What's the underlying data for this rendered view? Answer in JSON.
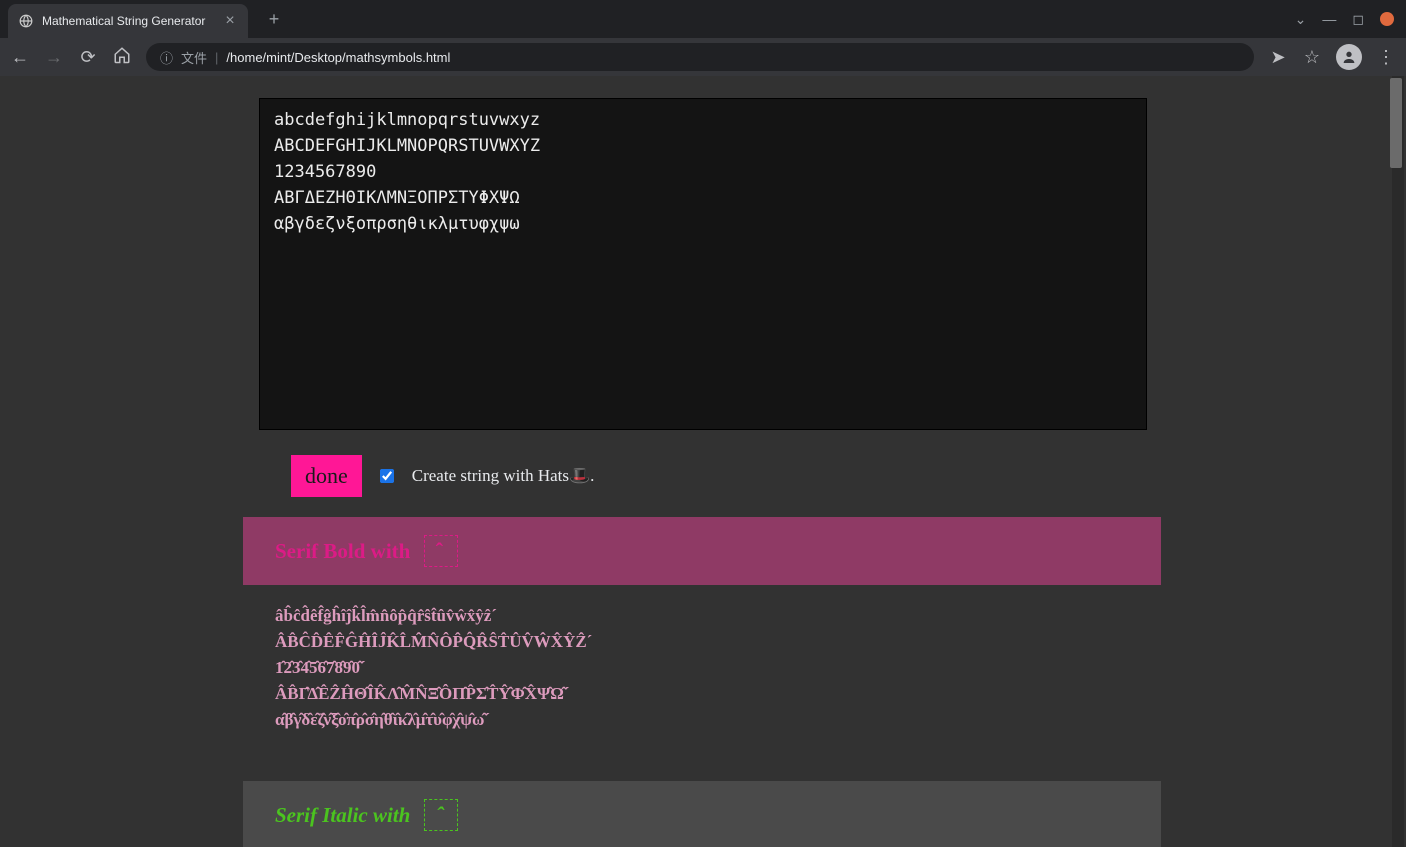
{
  "browser": {
    "tab_title": "Mathematical String Generator",
    "address": {
      "file_label": "文件",
      "path": "/home/mint/Desktop/mathsymbols.html"
    }
  },
  "input": {
    "textarea_value": "abcdefghijklmnopqrstuvwxyz\nABCDEFGHIJKLMNOPQRSTUVWXYZ\n1234567890\nΑΒΓΔΕΖΗΘΙΚΛΜΝΞΟΠΡΣΤΥΦΧΨΩ\nαβγδεζνξοπρσηθικλμτυφχψω"
  },
  "controls": {
    "done_label": "done",
    "hats_checked": true,
    "hats_label": "Create string with Hats🎩."
  },
  "sections": {
    "serif_bold": {
      "title": "Serif Bold with",
      "hat_glyph": "̂",
      "body": "âb̂ĉd̂êf̂ĝĥîĵk̂l̂m̂n̂ôp̂q̂r̂ŝt̂ûv̂ŵx̂ŷẑˊ\nÂB̂ĈD̂ÊF̂ĜĤÎĴK̂L̂M̂N̂ÔP̂Q̂R̂ŜT̂ÛV̂ŴX̂ŶẐˊ\n1̂2̂3̂4̂5̂6̂7̂8̂9̂0̂ˊ\nÂB̂Γ̂Δ̂ÊẐĤΘ̂ÎK̂Λ̂M̂N̂Ξ̂ÔΠ̂P̂Σ̂T̂Ŷ̂Φ̂X̂Ψ̂Ω̂ˊ\nα̂β̂γ̂δ̂ε̂ζ̂ν̂ξ̂ο̂π̂ρ̂σ̂η̂θ̂ι̂κ̂λ̂μ̂τ̂υ̂φ̂χ̂ψ̂ω̂ˊ"
    },
    "serif_italic": {
      "title": "Serif Italic with",
      "hat_glyph": "̂"
    }
  }
}
